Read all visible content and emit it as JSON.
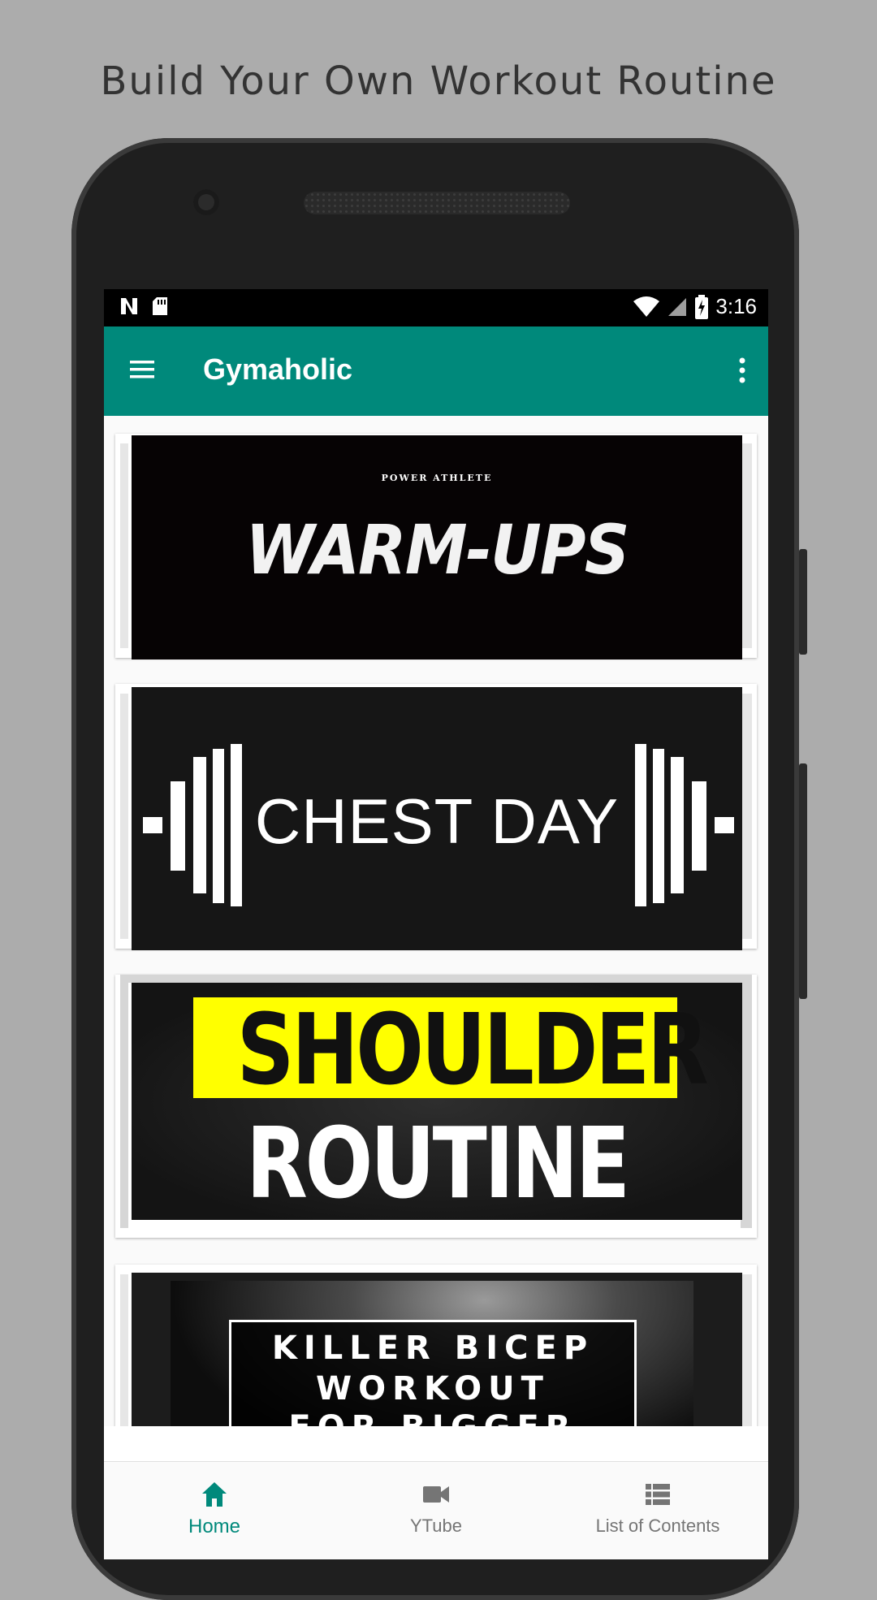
{
  "promo": {
    "caption": "Build Your Own Workout Routine"
  },
  "status_bar": {
    "time": "3:16"
  },
  "app_bar": {
    "title": "Gymaholic"
  },
  "cards": [
    {
      "id": "warm-ups",
      "subtitle": "POWER ATHLETE",
      "title": "WARM-UPS"
    },
    {
      "id": "chest-day",
      "title": "CHEST DAY"
    },
    {
      "id": "shoulder",
      "title_line1": "SHOULDER",
      "title_line2": "ROUTINE"
    },
    {
      "id": "biceps",
      "line1": "KILLER BICEP",
      "line2": "WORKOUT",
      "line3": "FOR BIGGER"
    }
  ],
  "bottom_nav": {
    "items": [
      {
        "label": "Home",
        "icon": "home-icon",
        "active": true
      },
      {
        "label": "YTube",
        "icon": "video-camera-icon",
        "active": false
      },
      {
        "label": "List of Contents",
        "icon": "list-icon",
        "active": false
      }
    ]
  },
  "colors": {
    "primary": "#00897b",
    "shoulder_highlight": "#ffff00"
  }
}
